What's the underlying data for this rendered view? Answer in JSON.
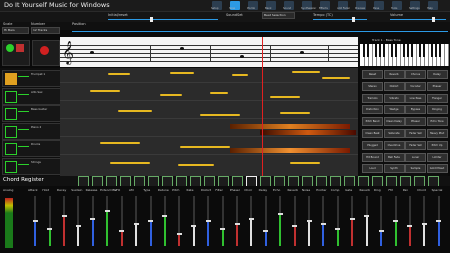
{
  "app": {
    "title": "Do It Yourself Music for Windows"
  },
  "toolbar": {
    "buttons": [
      "Setup",
      "Slow",
      "Plumb",
      "Bank",
      "Sound",
      "Synthesizer",
      "Effects",
      "Add Fader",
      "Preview",
      "Pane",
      "Tools",
      "Settings",
      "Help"
    ],
    "instrument_label": "Initial/reset",
    "soundset_label": "SoundSet",
    "soundset_value": "Beat Selection",
    "tempo_label": "Tempo (TC)",
    "volume_label": "Volume"
  },
  "sequence": {
    "scale_label": "Scale",
    "scale_value": "Hi Bars",
    "number_label": "Number",
    "number_value": "12 Tracks",
    "position_label": "Position"
  },
  "keyboard_label": "Track 1 - Bass Tone",
  "tracks": [
    {
      "name": "Trumpet 1"
    },
    {
      "name": "Alto Sax"
    },
    {
      "name": "Bass Guitar"
    },
    {
      "name": "Piano 2"
    },
    {
      "name": "Drums"
    },
    {
      "name": "Strings"
    }
  ],
  "fx_buttons": [
    [
      "Reset",
      "Reverb",
      "Chorus",
      "Delay"
    ],
    [
      "Stereo",
      "Distort",
      "Vocoder",
      "Phaser"
    ],
    [
      "Tremolo",
      "Vibrato",
      "Low Pass",
      "Flanger"
    ],
    [
      "Distortion",
      "Wedge",
      "Bypass",
      "Ringing"
    ],
    [
      "Pitch Bend",
      "Clean Delay",
      "Phaser",
      "Echo Tone"
    ],
    [
      "Clean Beat",
      "Saturate",
      "Fader Set",
      "Heavy Mod"
    ],
    [
      "Plugged",
      "Overdrive",
      "Fader Set",
      "Pitch Up"
    ],
    [
      "Hit Bound",
      "Bell Fade",
      "Lunar",
      "Limiter"
    ],
    [
      "Loud",
      "Synth",
      "Sample",
      "Gold Mixed"
    ]
  ],
  "chord": {
    "label": "Chord Register"
  },
  "mixer": {
    "analog_label": "Analog",
    "columns": [
      "Attack",
      "Hold",
      "Decay",
      "Sustain",
      "Release",
      "Extend Mix",
      "LFO",
      "AM",
      "Type",
      "Detune",
      "Pitch",
      "Rate",
      "Distort",
      "Filter",
      "Phaser",
      "Choir",
      "Delay",
      "Echo",
      "Reverb",
      "Noise",
      "Exciter",
      "Comp",
      "Gate",
      "Reverb",
      "Ring",
      "FM",
      "Pan",
      "Chord",
      "Special"
    ]
  },
  "colors": {
    "accent": "#2c9ae5",
    "note_gold": "#e6b820",
    "playhead": "#e02020",
    "track_green": "#2bd12b"
  }
}
